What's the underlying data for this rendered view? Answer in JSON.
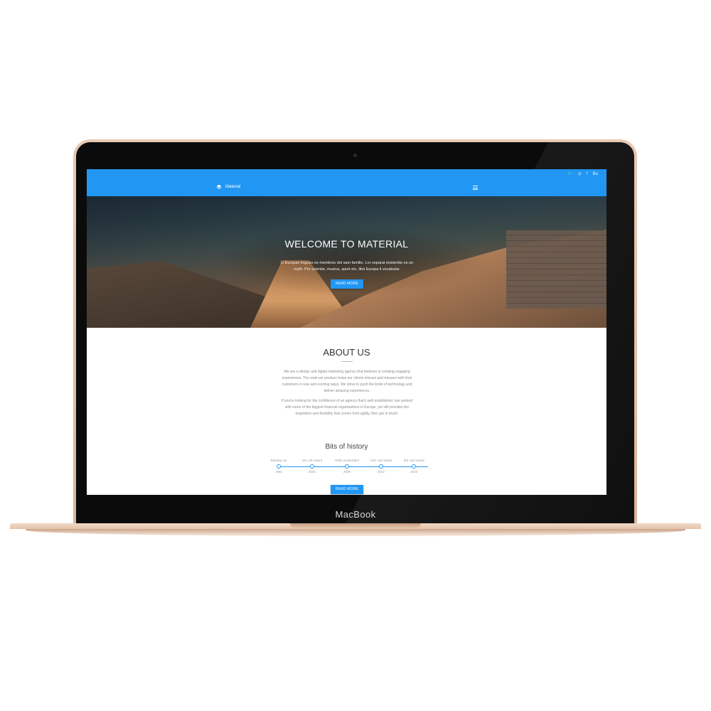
{
  "device": {
    "brand_label": "MacBook"
  },
  "topbar": {
    "socials": [
      "twitter-icon",
      "dribbble-icon",
      "facebook-icon",
      "behance-icon"
    ],
    "social_glyphs": [
      "🐦",
      "◎",
      "f",
      "Be"
    ],
    "logo_text": "Material",
    "accent_color": "#2196f3"
  },
  "hero": {
    "title": "WELCOME TO MATERIAL",
    "text": "Li Europan lingues es membres del sam familie. Lor separat existentie es un myth. Por scientie, musica, sport etc, litot Europa li vocabular.",
    "button_label": "READ MORE"
  },
  "about": {
    "title": "ABOUT US",
    "paragraph_1": "We are a design and digital marketing agency that believes in creating engaging experiences. The work we produce helps our clients interact and transact with their customers in new and exciting ways. We strive to push the limits of technology and deliver amazing experiences.",
    "paragraph_2": "If you're looking for the confidence of an agency that's well established, has worked with some of the biggest financial organisations in Europe, yet still provides the inspiration and flexibility that comes from agility, then get in touch."
  },
  "history": {
    "title": "Bits of history",
    "items": [
      {
        "label": "Starting out",
        "year": "1991"
      },
      {
        "label": "1st .net Award",
        "year": "2001"
      },
      {
        "label": "Hello Amsterdam",
        "year": "2009"
      },
      {
        "label": "2nd .net Award",
        "year": "2012"
      },
      {
        "label": "3rd .net Award",
        "year": "2015"
      }
    ],
    "button_label": "READ MORE"
  }
}
